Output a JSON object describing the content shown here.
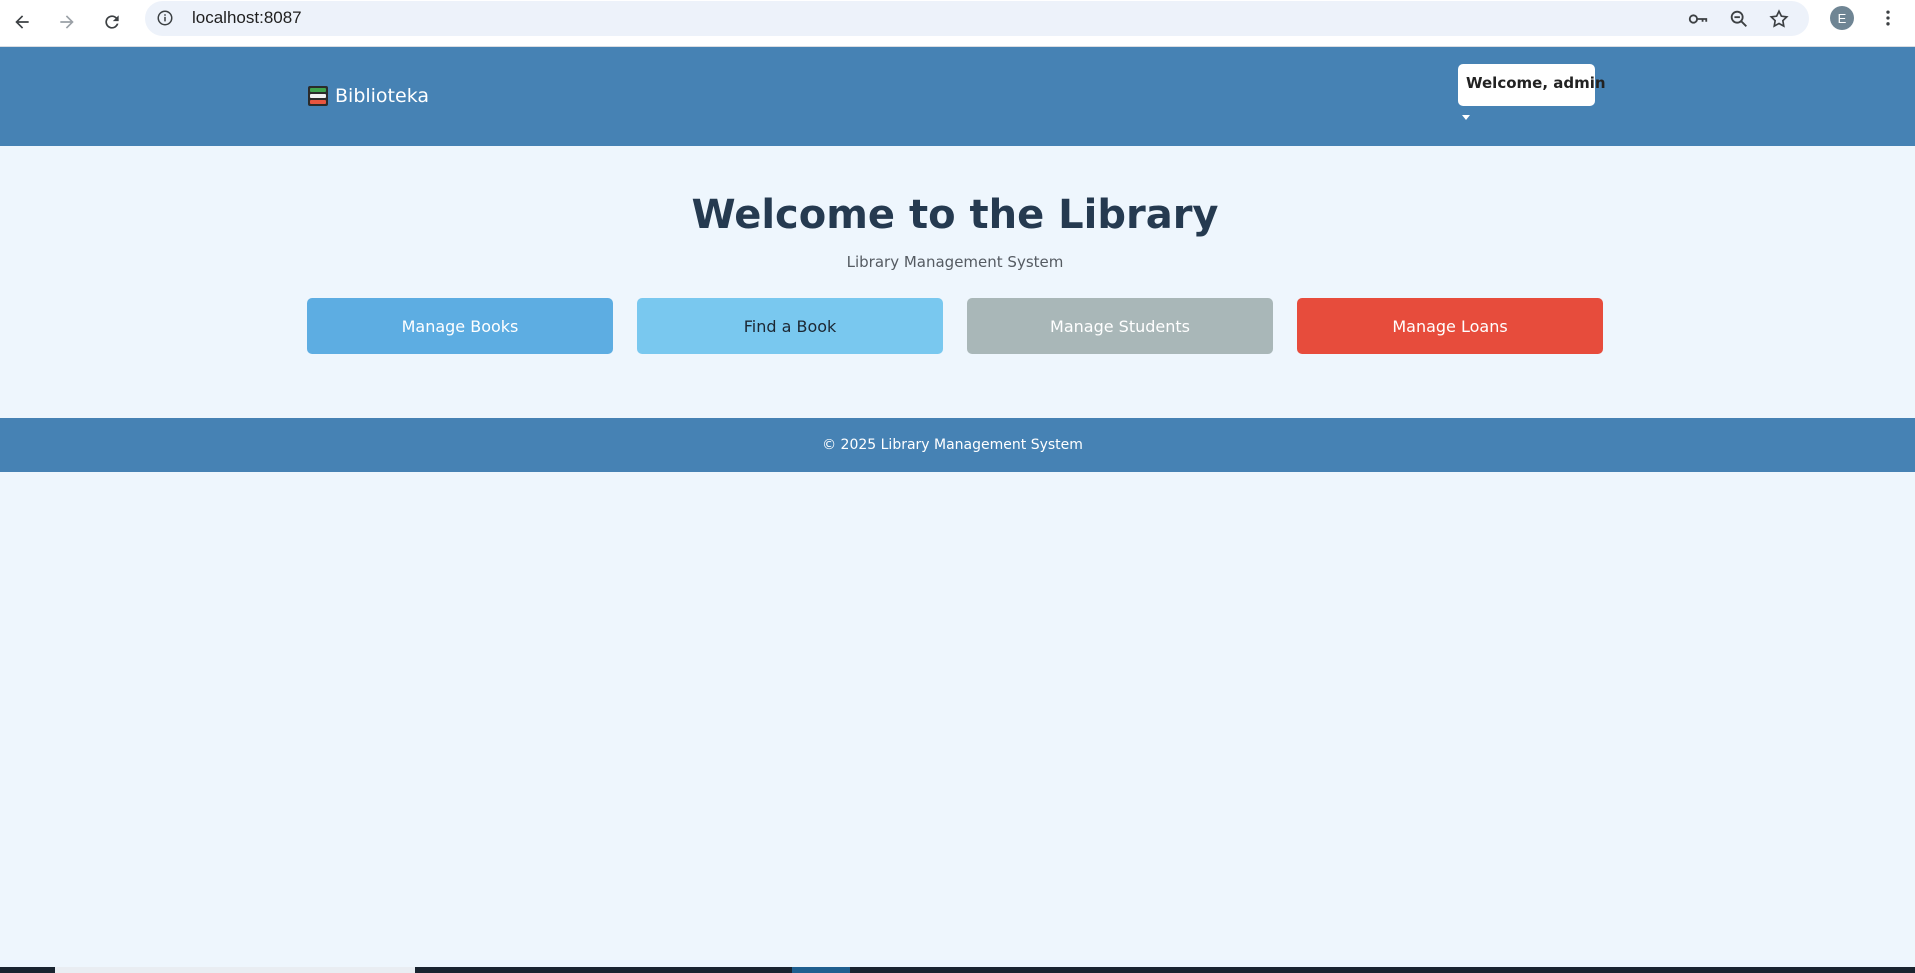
{
  "browser": {
    "url": "localhost:8087",
    "profile_initial": "E",
    "icons": [
      "back-arrow-icon",
      "forward-arrow-icon",
      "reload-icon",
      "site-info-icon",
      "password-key-icon",
      "zoom-icon",
      "bookmark-star-icon",
      "more-vert-icon"
    ]
  },
  "header": {
    "brand_icon": "books-icon",
    "brand_name": "Biblioteka",
    "user_menu_label": "Welcome, admin"
  },
  "main": {
    "title": "Welcome to the Library",
    "subtitle": "Library Management System",
    "actions": [
      {
        "label": "Manage Books",
        "color": "#5dade2"
      },
      {
        "label": "Find a Book",
        "color": "#79c8ef"
      },
      {
        "label": "Manage Students",
        "color": "#a9b7b8"
      },
      {
        "label": "Manage Loans",
        "color": "#e74c3c"
      }
    ]
  },
  "footer": {
    "text": "© 2025 Library Management System"
  },
  "colors": {
    "header_bg": "#4682b4",
    "page_bg": "#eef6fd",
    "title": "#253a50"
  }
}
